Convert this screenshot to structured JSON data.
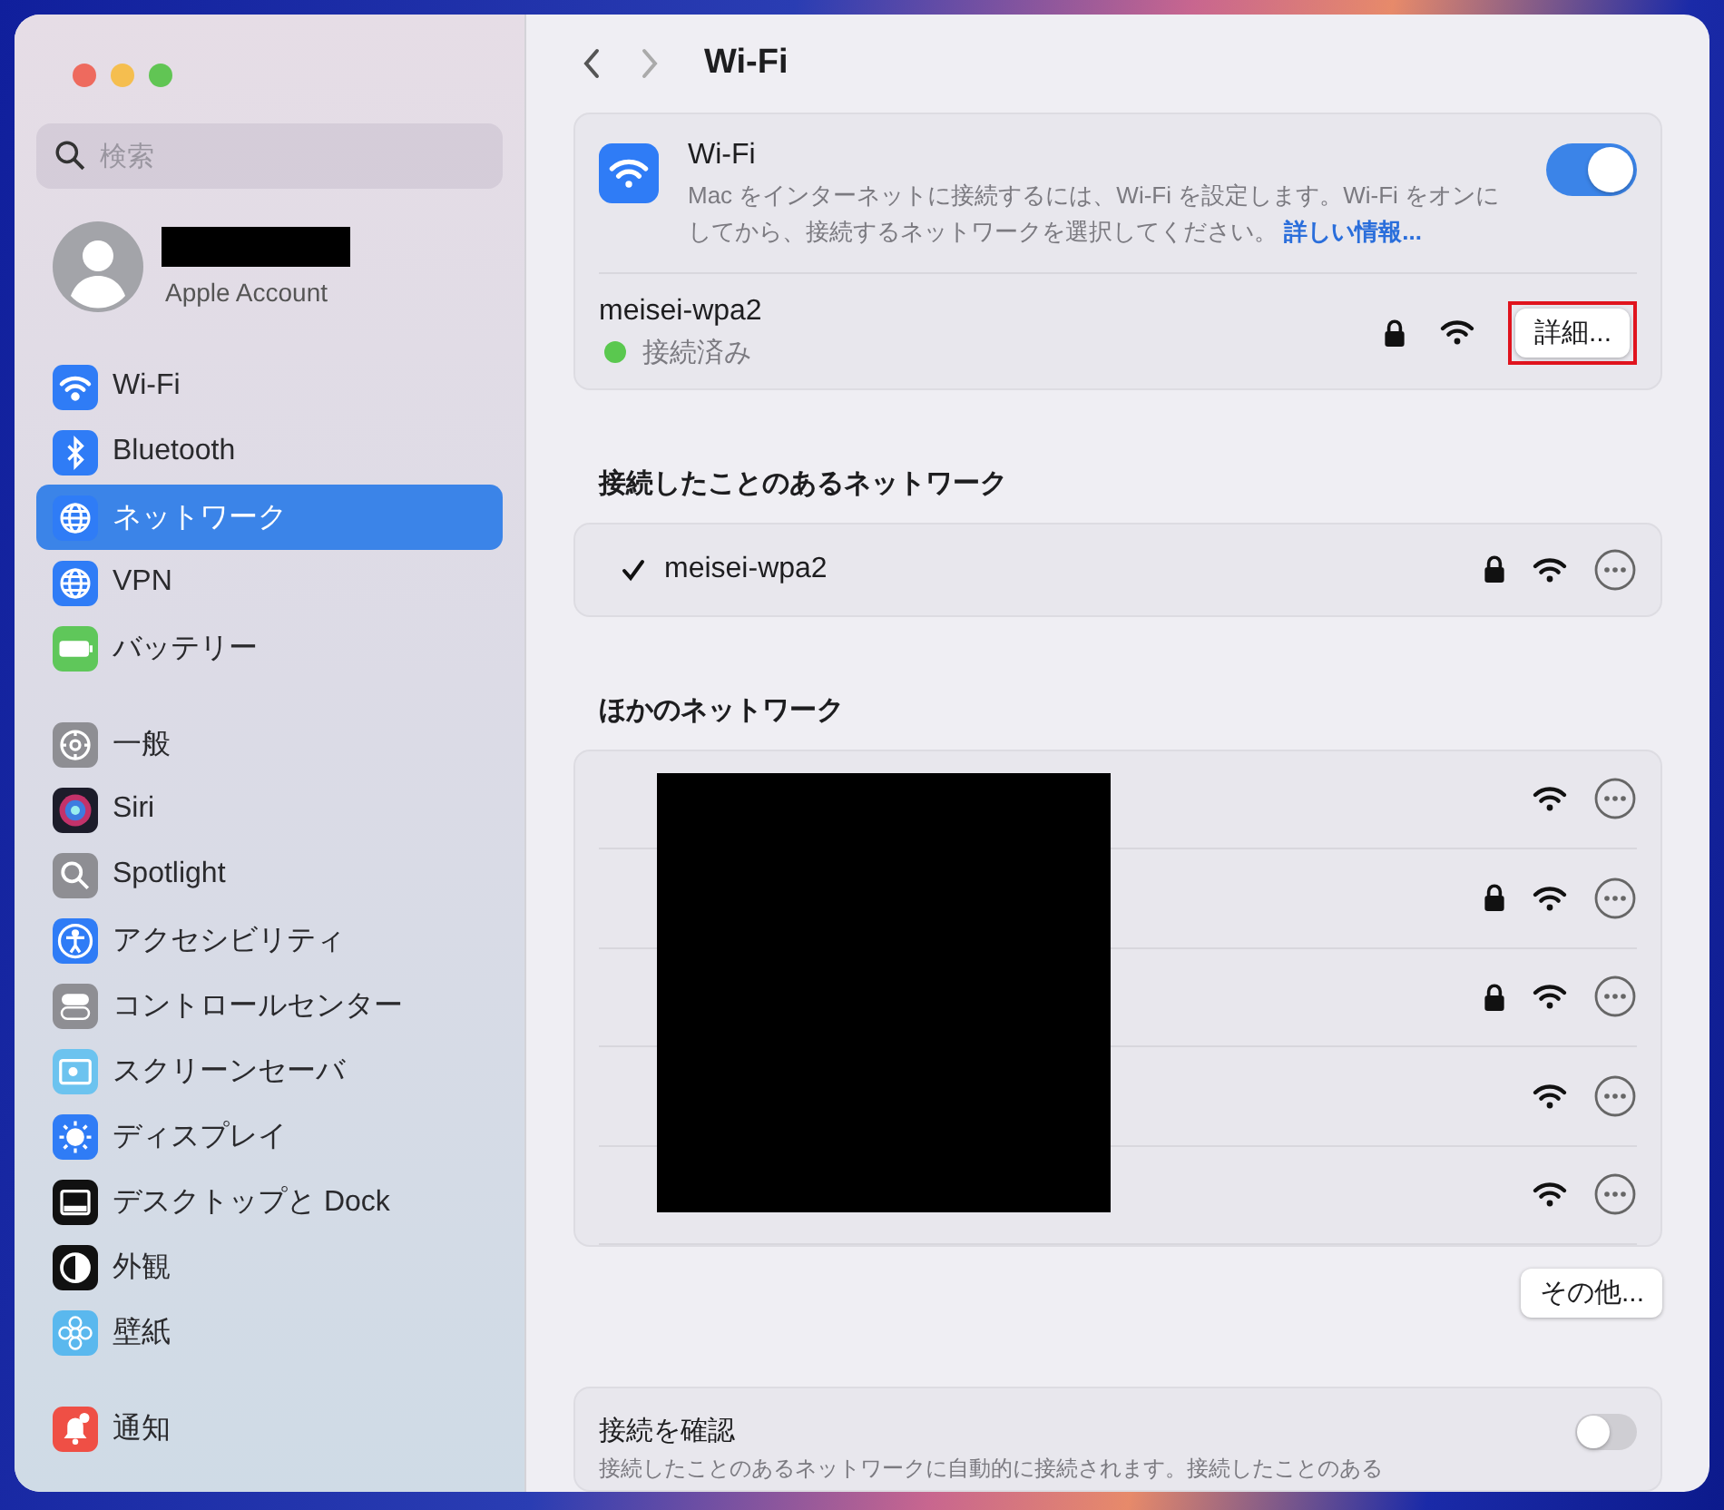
{
  "window": {
    "title": "Wi-Fi"
  },
  "search": {
    "placeholder": "検索"
  },
  "account": {
    "name_redacted": true,
    "subtitle": "Apple Account"
  },
  "sidebar": {
    "groups": [
      {
        "items": [
          {
            "label": "Wi-Fi",
            "selected": false
          },
          {
            "label": "Bluetooth",
            "selected": false
          },
          {
            "label": "ネットワーク",
            "selected": true
          },
          {
            "label": "VPN",
            "selected": false
          },
          {
            "label": "バッテリー",
            "selected": false
          }
        ]
      },
      {
        "items": [
          {
            "label": "一般",
            "selected": false
          },
          {
            "label": "Siri",
            "selected": false
          },
          {
            "label": "Spotlight",
            "selected": false
          },
          {
            "label": "アクセシビリティ",
            "selected": false
          },
          {
            "label": "コントロールセンター",
            "selected": false
          },
          {
            "label": "スクリーンセーバ",
            "selected": false
          },
          {
            "label": "ディスプレイ",
            "selected": false
          },
          {
            "label": "デスクトップと Dock",
            "selected": false
          },
          {
            "label": "外観",
            "selected": false
          },
          {
            "label": "壁紙",
            "selected": false
          }
        ]
      },
      {
        "items": [
          {
            "label": "通知",
            "selected": false
          }
        ]
      }
    ]
  },
  "wifi": {
    "title": "Wi-Fi",
    "description": "Mac をインターネットに接続するには、Wi-Fi を設定します。Wi-Fi をオンにしてから、接続するネットワークを選択してください。",
    "link": "詳しい情報...",
    "on": true,
    "current": {
      "name": "meisei-wpa2",
      "status": "接続済み",
      "locked": true,
      "button": "詳細...",
      "highlighted": true
    }
  },
  "known_networks": {
    "heading": "接続したことのあるネットワーク",
    "items": [
      {
        "name": "meisei-wpa2",
        "checked": true,
        "locked": true
      }
    ]
  },
  "other_networks": {
    "heading": "ほかのネットワーク",
    "names_redacted": true,
    "items": [
      {
        "locked": false
      },
      {
        "locked": true
      },
      {
        "locked": true
      },
      {
        "locked": false
      },
      {
        "locked": false
      }
    ]
  },
  "other_button": "その他...",
  "check_connection": {
    "title": "接続を確認",
    "description": "接続したことのあるネットワークに自動的に接続されます。接続したことのある",
    "on": false
  }
}
